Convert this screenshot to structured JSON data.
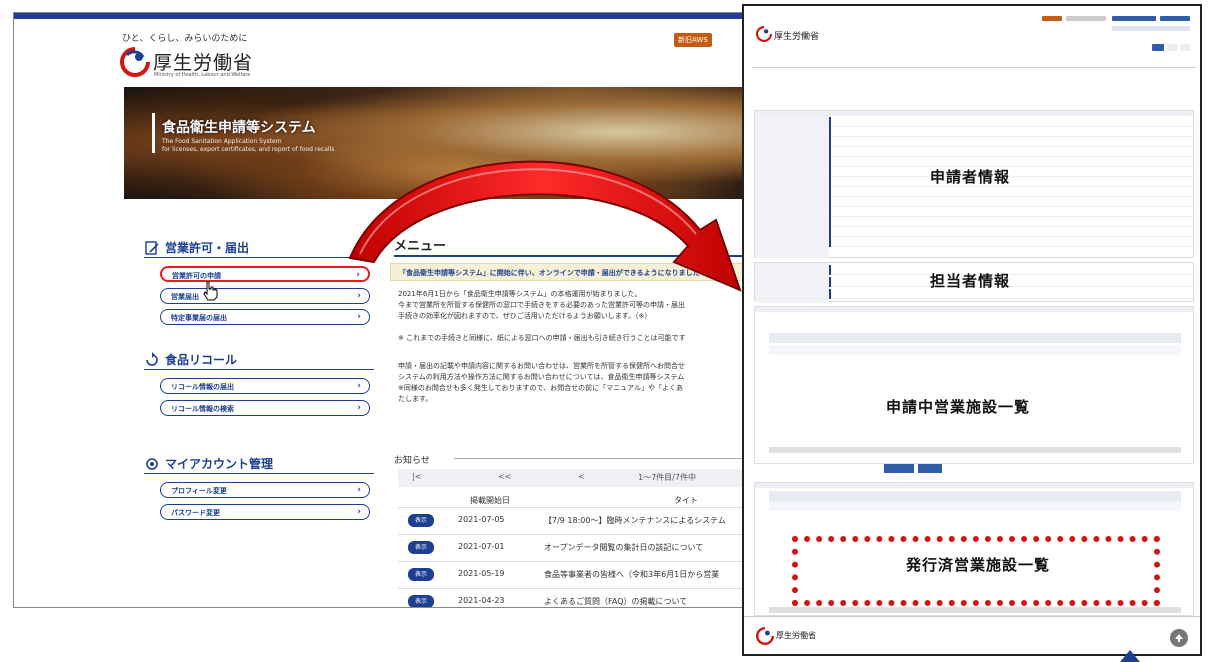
{
  "main_page": {
    "tagline": "ひと、くらし、みらいのために",
    "ministry": "厚生労働省",
    "ministry_en": "Ministry of Health, Labour and Welfare",
    "header_button_aws": "新旧AWS",
    "hero": {
      "title": "食品衛生申請等システム",
      "subtitle_1": "The Food Sanitation Application System",
      "subtitle_2": "for licenses, export certificates, and report of food recalls"
    },
    "sections": [
      {
        "title": "営業許可・届出",
        "items": [
          "営業許可の申請",
          "営業届出",
          "特定事業届の届出"
        ]
      },
      {
        "title": "食品リコール",
        "items": [
          "リコール情報の届出",
          "リコール情報の検索"
        ]
      },
      {
        "title": "マイアカウント管理",
        "items": [
          "プロフィール変更",
          "パスワード変更"
        ]
      }
    ],
    "menu_title": "メニュー",
    "notice": "「食品衛生申請等システム」に開始に伴い、オンラインで申請・届出ができるようになりました",
    "body_lines": [
      "2021年6月1日から「食品衛生申請等システム」の本格運用が始まりました。",
      "今まで営業所を所管する保健所の窓口で手続きをする必要のあった営業許可等の申請・届出",
      "手続きの効率化が図れますので、ぜひご活用いただけるようお願いします。（※）",
      "",
      "※ これまでの手続きと同様に、紙による窓口への申請・届出も引き続き行うことは可能です",
      "",
      "申請・届出の記載や申請内容に関するお問い合わせは、営業所を所管する保健所へお問合せ",
      "システムの利用方法や操作方法に関するお問い合わせについては、食品衛生申請等システム",
      "※同様のお問合せも多く発生しておりますので、お問合せの前に「マニュアル」や「よくあ",
      "たします。"
    ],
    "news": {
      "label": "お知らせ",
      "pager_first": "|<",
      "pager_prev2": "<<",
      "pager_prev": "<",
      "pager_info": "1～7件目/7件中",
      "col_date": "掲載開始日",
      "col_title": "タイト",
      "badge": "表示",
      "rows": [
        {
          "date": "2021-07-05",
          "title": "【7/9 18:00～】臨時メンテナンスによるシステム"
        },
        {
          "date": "2021-07-01",
          "title": "オープンデータ閲覧の集計日の該記について"
        },
        {
          "date": "2021-05-19",
          "title": "食品等事業者の皆様へ（令和3年6月1日から営業"
        },
        {
          "date": "2021-04-23",
          "title": "よくあるご質問（FAQ）の掲載について"
        }
      ]
    }
  },
  "detail_page": {
    "ministry": "厚生労働省",
    "section_applicant": "申請者情報",
    "section_contact": "担当者情報",
    "section_applying": "申請中営業施設一覧",
    "section_issued": "発行済営業施設一覧"
  },
  "colors": {
    "brand_navy": "#1d3f91",
    "highlight_red": "#e02020",
    "arrow_red": "#d41414"
  }
}
